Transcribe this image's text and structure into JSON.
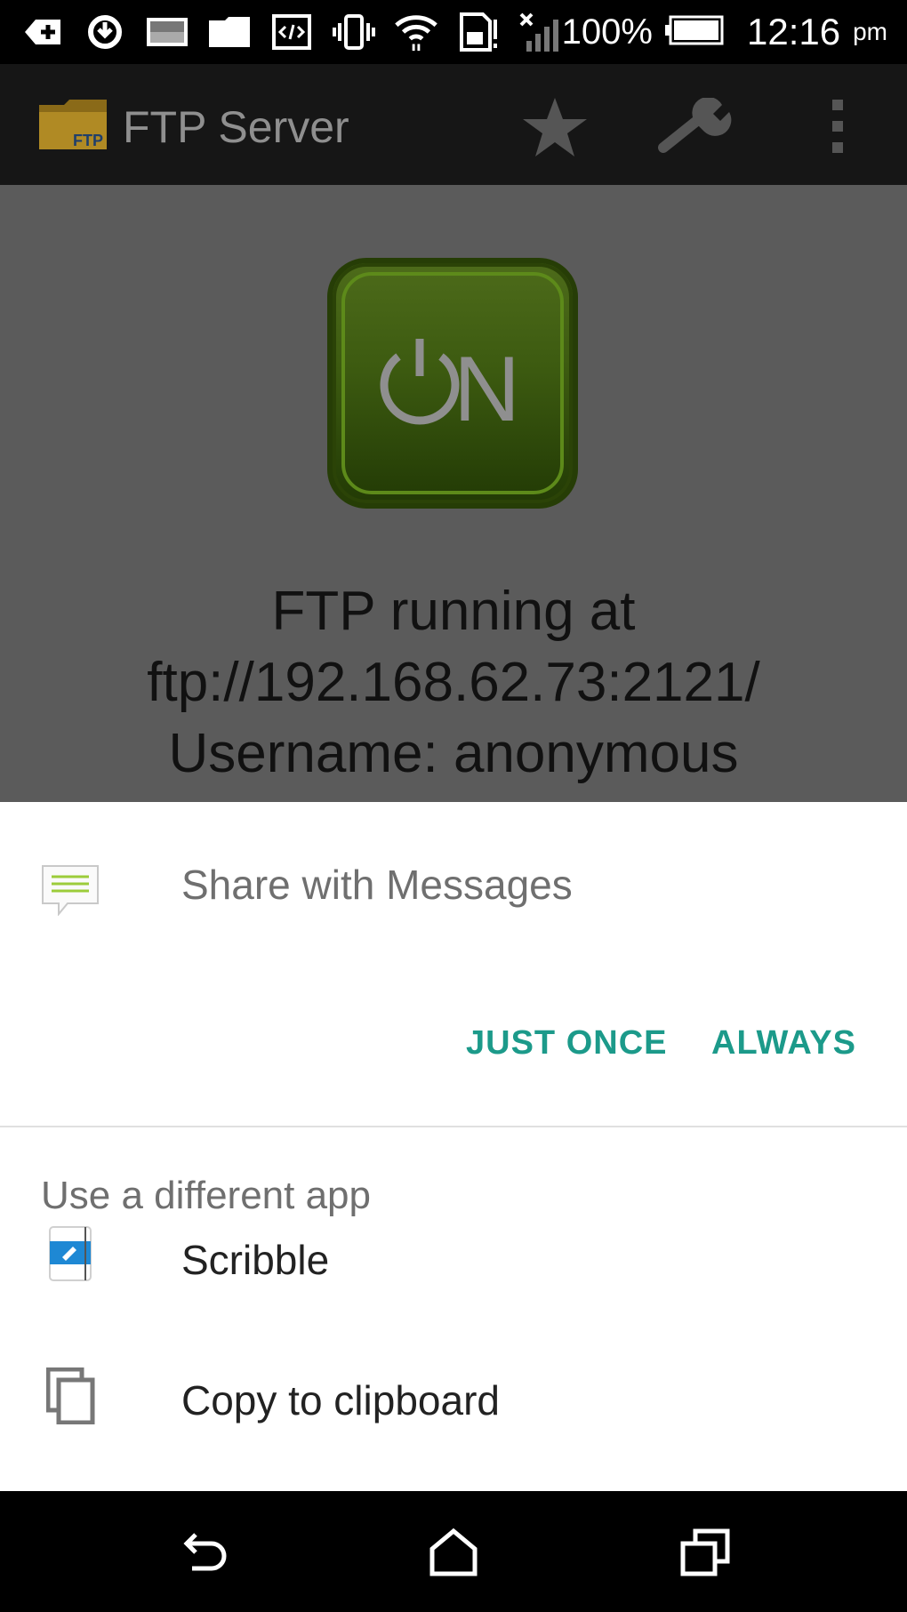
{
  "status_bar": {
    "battery_percent": "100%",
    "time": "12:16",
    "ampm": "pm",
    "icons": [
      "download-icon",
      "sync-icon",
      "image-icon",
      "folder-icon",
      "code-icon",
      "vibrate-icon",
      "wifi-icon",
      "sd-card-icon",
      "no-signal-icon",
      "battery-icon"
    ]
  },
  "app_bar": {
    "title": "FTP Server",
    "icon_badge": "FTP",
    "actions": [
      "star-icon",
      "wrench-icon",
      "overflow-menu-icon"
    ]
  },
  "main": {
    "power_button_label": "ON",
    "status_lines": [
      "FTP running at",
      "ftp://192.168.62.73:2121/",
      "Username: anonymous"
    ]
  },
  "share_sheet": {
    "share_label": "Share with Messages",
    "just_once": "JUST ONCE",
    "always": "ALWAYS",
    "other_heading": "Use a different app",
    "apps": [
      {
        "label": "Scribble",
        "icon": "scribble-icon"
      },
      {
        "label": "Copy to clipboard",
        "icon": "clipboard-icon"
      }
    ],
    "accent_color": "#1c9a8a"
  },
  "nav_bar": {
    "buttons": [
      "back-icon",
      "home-icon",
      "recents-icon"
    ]
  }
}
